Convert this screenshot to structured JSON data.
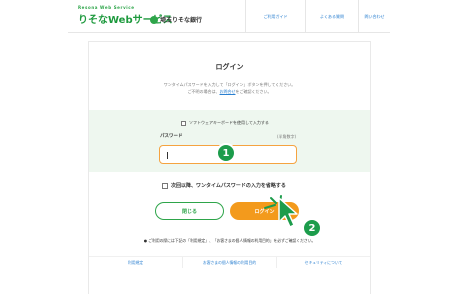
{
  "header": {
    "brand_sub": "Resona Web Service",
    "brand_main": "りそなWebサービス",
    "bank_name": "埼玉りそな銀行",
    "nav": [
      "ご利用ガイド",
      "よくある質問",
      "問い合わせ"
    ]
  },
  "login": {
    "title": "ログイン",
    "desc_line1": "ワンタイムパスワードを入力して「ログイン」ボタンを押してください。",
    "desc_line2_prefix": "ご不明の場合は、",
    "desc_link": "お問合せ",
    "desc_line2_suffix": "をご確認ください。",
    "software_keyboard_label": "ソフトウェアキーボードを使用して入力する",
    "password_label": "パスワード",
    "password_hint": "(半角数字)",
    "password_value": "",
    "keep_label": "次回以降、ワンタイムパスワードの入力を省略する",
    "close_button": "閉じる",
    "login_button": "ログイン",
    "notice": "● ご利用の際には下記の「利用規定」、「お客さまの個人情報の利用目的」を必ずご確認ください。",
    "footer_links": [
      "利用規定",
      "お客さまの個人情報の利用目的",
      "セキュリティについて"
    ]
  },
  "annotations": {
    "marker1": "1",
    "marker2": "2",
    "marker_color": "#1c9c4b",
    "arrow_icon": "pointer-arrow-icon"
  },
  "colors": {
    "brand_green": "#2ea54a",
    "accent_orange": "#f39a1c",
    "link_blue": "#2a7fd0"
  }
}
